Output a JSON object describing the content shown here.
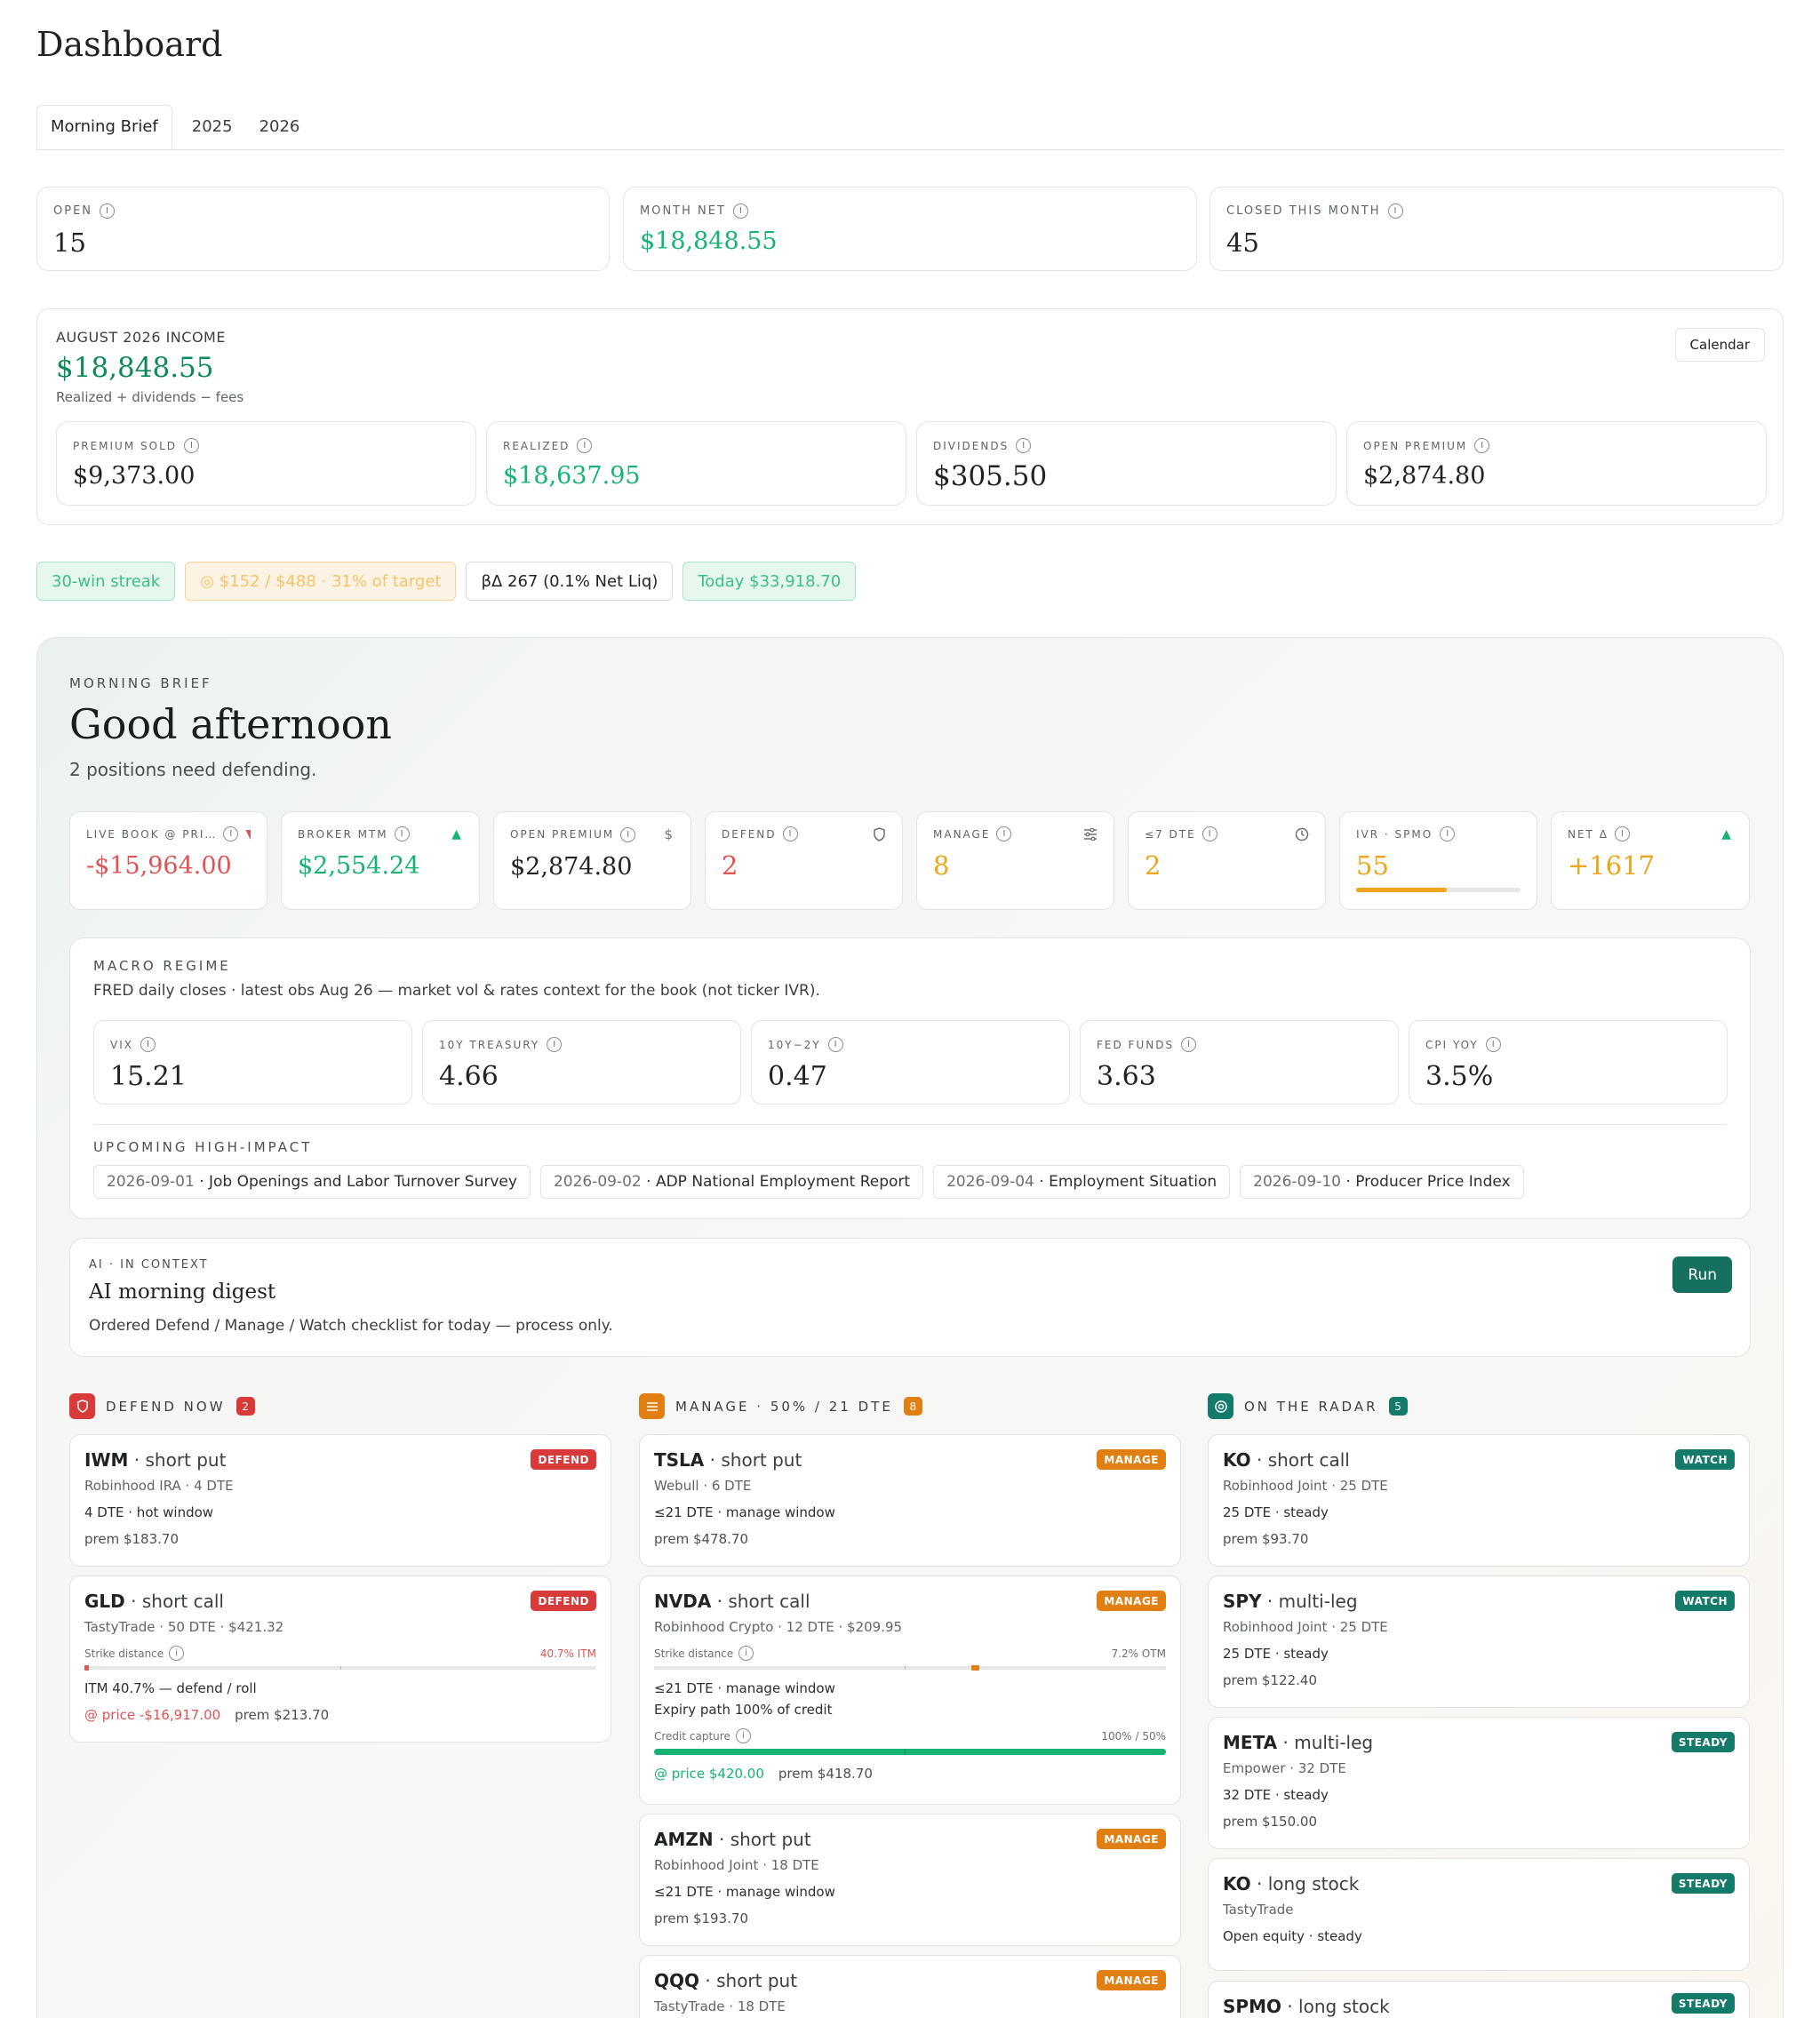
{
  "page_title": "Dashboard",
  "tabs": [
    {
      "label": "Morning Brief"
    },
    {
      "label": "2025"
    },
    {
      "label": "2026"
    }
  ],
  "stats": [
    {
      "label": "OPEN",
      "value": "15"
    },
    {
      "label": "MONTH NET",
      "value": "$18,848.55"
    },
    {
      "label": "CLOSED THIS MONTH",
      "value": "45"
    }
  ],
  "income": {
    "title": "AUGUST 2026 INCOME",
    "value": "$18,848.55",
    "subtitle": "Realized + dividends − fees",
    "calendar_label": "Calendar",
    "cards": [
      {
        "label": "PREMIUM SOLD",
        "value": "$9,373.00"
      },
      {
        "label": "REALIZED",
        "value": "$18,637.95"
      },
      {
        "label": "DIVIDENDS",
        "value": "$305.50"
      },
      {
        "label": "OPEN PREMIUM",
        "value": "$2,874.80"
      }
    ]
  },
  "pills": {
    "streak": "30-win streak",
    "target": "◎ $152 / $488 · 31% of target",
    "beta": "βΔ 267 (0.1% Net Liq)",
    "today": "Today $33,918.70"
  },
  "brief": {
    "eyebrow": "MORNING BRIEF",
    "greeting": "Good afternoon",
    "summary": "2 positions need defending.",
    "metrics": [
      {
        "label": "LIVE BOOK @ PRI…",
        "value": "-$15,964.00",
        "icon": "triangle-down"
      },
      {
        "label": "BROKER MTM",
        "value": "$2,554.24",
        "icon": "triangle-up"
      },
      {
        "label": "OPEN PREMIUM",
        "value": "$2,874.80",
        "icon": "$"
      },
      {
        "label": "DEFEND",
        "value": "2",
        "icon": "shield"
      },
      {
        "label": "MANAGE",
        "value": "8",
        "icon": "sliders"
      },
      {
        "label": "≤7 DTE",
        "value": "2",
        "icon": "clock"
      },
      {
        "label": "IVR · SPMO",
        "value": "55",
        "progress": 0.55
      },
      {
        "label": "NET Δ",
        "value": "+1617",
        "icon": "triangle-up"
      }
    ],
    "colors": {
      "green": "#16b374",
      "red": "#e05454",
      "orange": "#eca61c"
    }
  },
  "macro": {
    "title": "MACRO REGIME",
    "desc": "FRED daily closes · latest obs Aug 26 — market vol & rates context for the book (not ticker IVR).",
    "cards": [
      {
        "label": "VIX",
        "value": "15.21"
      },
      {
        "label": "10Y TREASURY",
        "value": "4.66"
      },
      {
        "label": "10Y−2Y",
        "value": "0.47"
      },
      {
        "label": "FED FUNDS",
        "value": "3.63"
      },
      {
        "label": "CPI YOY",
        "value": "3.5%"
      }
    ],
    "upcoming_title": "UPCOMING HIGH-IMPACT",
    "events": [
      {
        "date": "2026-09-01",
        "name": "Job Openings and Labor Turnover Survey"
      },
      {
        "date": "2026-09-02",
        "name": "ADP National Employment Report"
      },
      {
        "date": "2026-09-04",
        "name": "Employment Situation"
      },
      {
        "date": "2026-09-10",
        "name": "Producer Price Index"
      }
    ]
  },
  "ai": {
    "eyebrow": "AI · IN CONTEXT",
    "title": "AI morning digest",
    "desc": "Ordered Defend / Manage / Watch checklist for today — process only.",
    "run_label": "Run"
  },
  "columns": {
    "defend": {
      "title": "DEFEND NOW",
      "count": "2"
    },
    "manage": {
      "title": "MANAGE · 50% / 21 DTE",
      "count": "8"
    },
    "radar": {
      "title": "ON THE RADAR",
      "count": "5"
    }
  },
  "defend_items": [
    {
      "ticker": "IWM",
      "kind": "short put",
      "badge": "DEFEND",
      "sub": "Robinhood IRA · 4 DTE",
      "line": "4 DTE · hot window",
      "prem": "prem $183.70"
    },
    {
      "ticker": "GLD",
      "kind": "short call",
      "badge": "DEFEND",
      "sub": "TastyTrade · 50 DTE · $421.32",
      "sd_label": "Strike distance",
      "sd_value": "40.7% ITM",
      "line": "ITM 40.7% — defend / roll",
      "at_price": "@ price -$16,917.00",
      "prem": "prem $213.70"
    }
  ],
  "manage_items": [
    {
      "ticker": "TSLA",
      "kind": "short put",
      "badge": "MANAGE",
      "sub": "Webull · 6 DTE",
      "line": "≤21 DTE · manage window",
      "prem": "prem $478.70"
    },
    {
      "ticker": "NVDA",
      "kind": "short call",
      "badge": "MANAGE",
      "sub": "Robinhood Crypto · 12 DTE · $209.95",
      "sd_label": "Strike distance",
      "sd_value": "7.2% OTM",
      "line": "≤21 DTE · manage window",
      "line2": "Expiry path 100% of credit",
      "cc_label": "Credit capture",
      "cc_value": "100% / 50%",
      "cc_fill": 1.0,
      "at_price": "@ price $420.00",
      "prem": "prem $418.70"
    },
    {
      "ticker": "AMZN",
      "kind": "short put",
      "badge": "MANAGE",
      "sub": "Robinhood Joint · 18 DTE",
      "line": "≤21 DTE · manage window",
      "prem": "prem $193.70"
    },
    {
      "ticker": "QQQ",
      "kind": "short put",
      "badge": "MANAGE",
      "sub": "TastyTrade · 18 DTE"
    }
  ],
  "radar_items": [
    {
      "ticker": "KO",
      "kind": "short call",
      "badge": "WATCH",
      "sub": "Robinhood Joint · 25 DTE",
      "line": "25 DTE · steady",
      "prem": "prem $93.70"
    },
    {
      "ticker": "SPY",
      "kind": "multi-leg",
      "badge": "WATCH",
      "sub": "Robinhood Joint · 25 DTE",
      "line": "25 DTE · steady",
      "prem": "prem $122.40"
    },
    {
      "ticker": "META",
      "kind": "multi-leg",
      "badge": "STEADY",
      "sub": "Empower · 32 DTE",
      "line": "32 DTE · steady",
      "prem": "prem $150.00"
    },
    {
      "ticker": "KO",
      "kind": "long stock",
      "badge": "STEADY",
      "sub": "TastyTrade",
      "line": "Open equity · steady"
    },
    {
      "ticker": "SPMO",
      "kind": "long stock",
      "badge": "STEADY"
    }
  ]
}
